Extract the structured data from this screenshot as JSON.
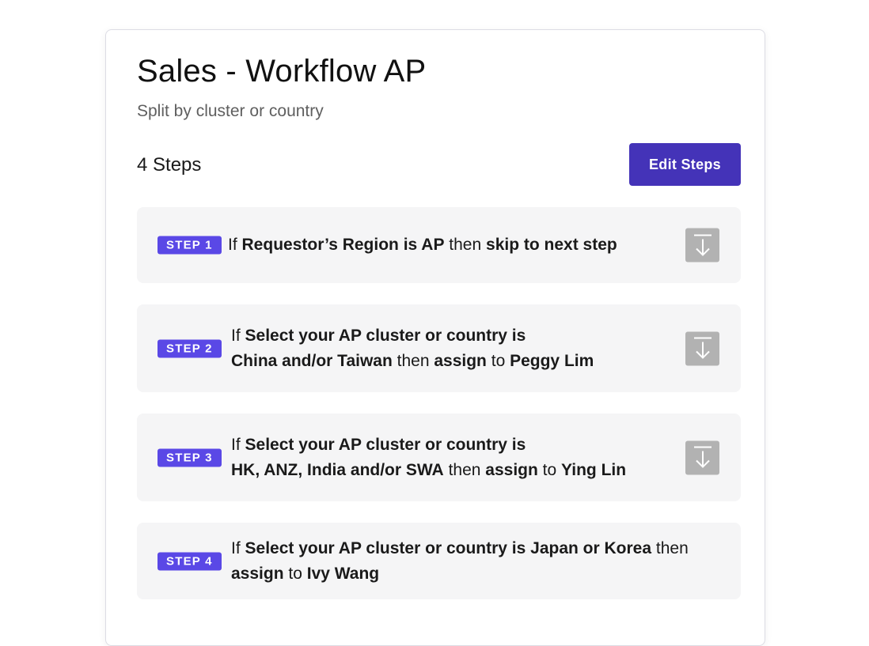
{
  "workflow": {
    "title": "Sales - Workflow AP",
    "subtitle": "Split by cluster or country",
    "steps_count": "4 Steps",
    "edit_button": "Edit Steps"
  },
  "colors": {
    "accent_button": "#4433b8",
    "badge": "#5a48e6",
    "step_background": "#f5f5f6",
    "move_icon_background": "#b2b2b2"
  },
  "steps": [
    {
      "badge": "STEP 1",
      "if": "If",
      "condition": "Requestor’s Region is AP",
      "then": "then",
      "action": "skip to next step",
      "has_move_icon": true
    },
    {
      "badge": "STEP 2",
      "if": "If",
      "field": "Select your AP cluster or country is",
      "value": "China and/or Taiwan",
      "then": "then",
      "action": "assign",
      "to": "to",
      "assignee": "Peggy Lim",
      "has_move_icon": true
    },
    {
      "badge": "STEP 3",
      "if": "If",
      "field": "Select your AP cluster or country is",
      "value": "HK, ANZ, India and/or SWA",
      "then": "then",
      "action": "assign",
      "to": "to",
      "assignee": "Ying Lin",
      "has_move_icon": true
    },
    {
      "badge": "STEP 4",
      "if": "If",
      "field": "Select your AP cluster or country is",
      "value": "Japan or Korea",
      "then": "then",
      "action": "assign",
      "to": "to",
      "assignee": "Ivy Wang",
      "has_move_icon": false
    }
  ]
}
